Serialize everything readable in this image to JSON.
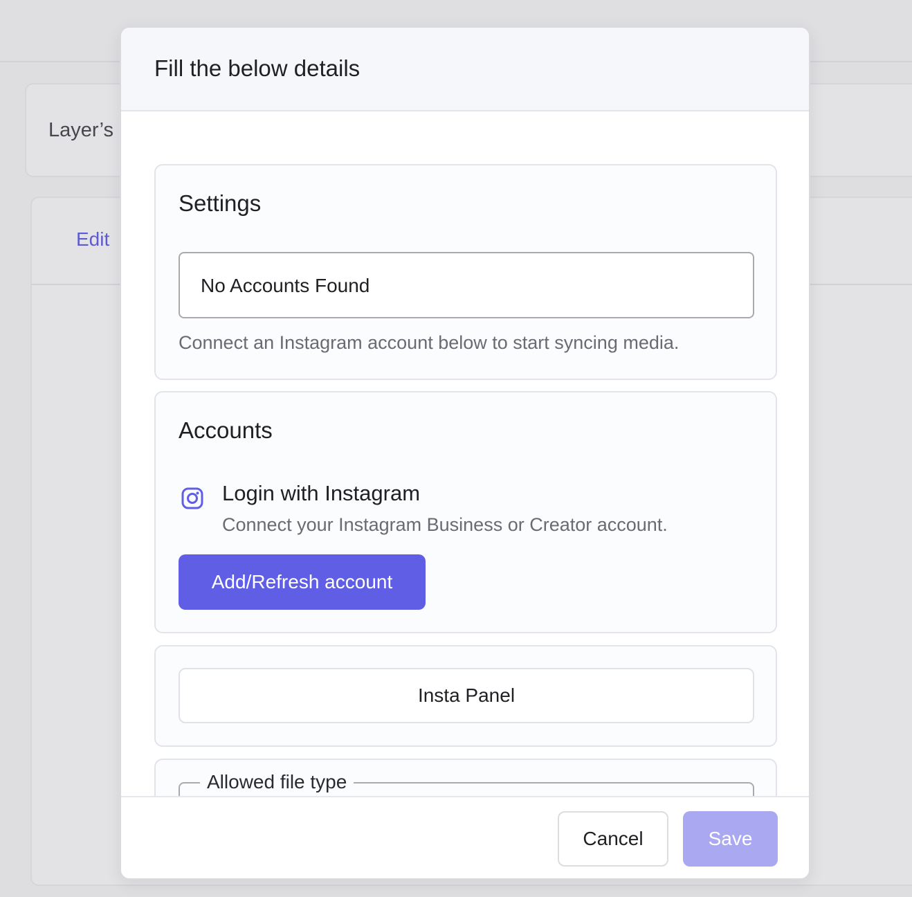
{
  "background": {
    "card_title": "Layer’s S",
    "tab_edit": "Edit"
  },
  "modal": {
    "title": "Fill the below details",
    "settings": {
      "heading": "Settings",
      "account_select_value": "No Accounts Found",
      "helper": "Connect an Instagram account below to start syncing media."
    },
    "accounts": {
      "heading": "Accounts",
      "icon": "instagram-icon",
      "login_title": "Login with Instagram",
      "login_desc": "Connect your Instagram Business or Creator account.",
      "add_button": "Add/Refresh account"
    },
    "panel": {
      "button_label": "Insta Panel"
    },
    "file_type": {
      "legend": "Allowed file type"
    },
    "footer": {
      "cancel": "Cancel",
      "save": "Save"
    }
  },
  "colors": {
    "accent": "#5f5ee4",
    "accent_disabled": "#a9a8f0"
  }
}
